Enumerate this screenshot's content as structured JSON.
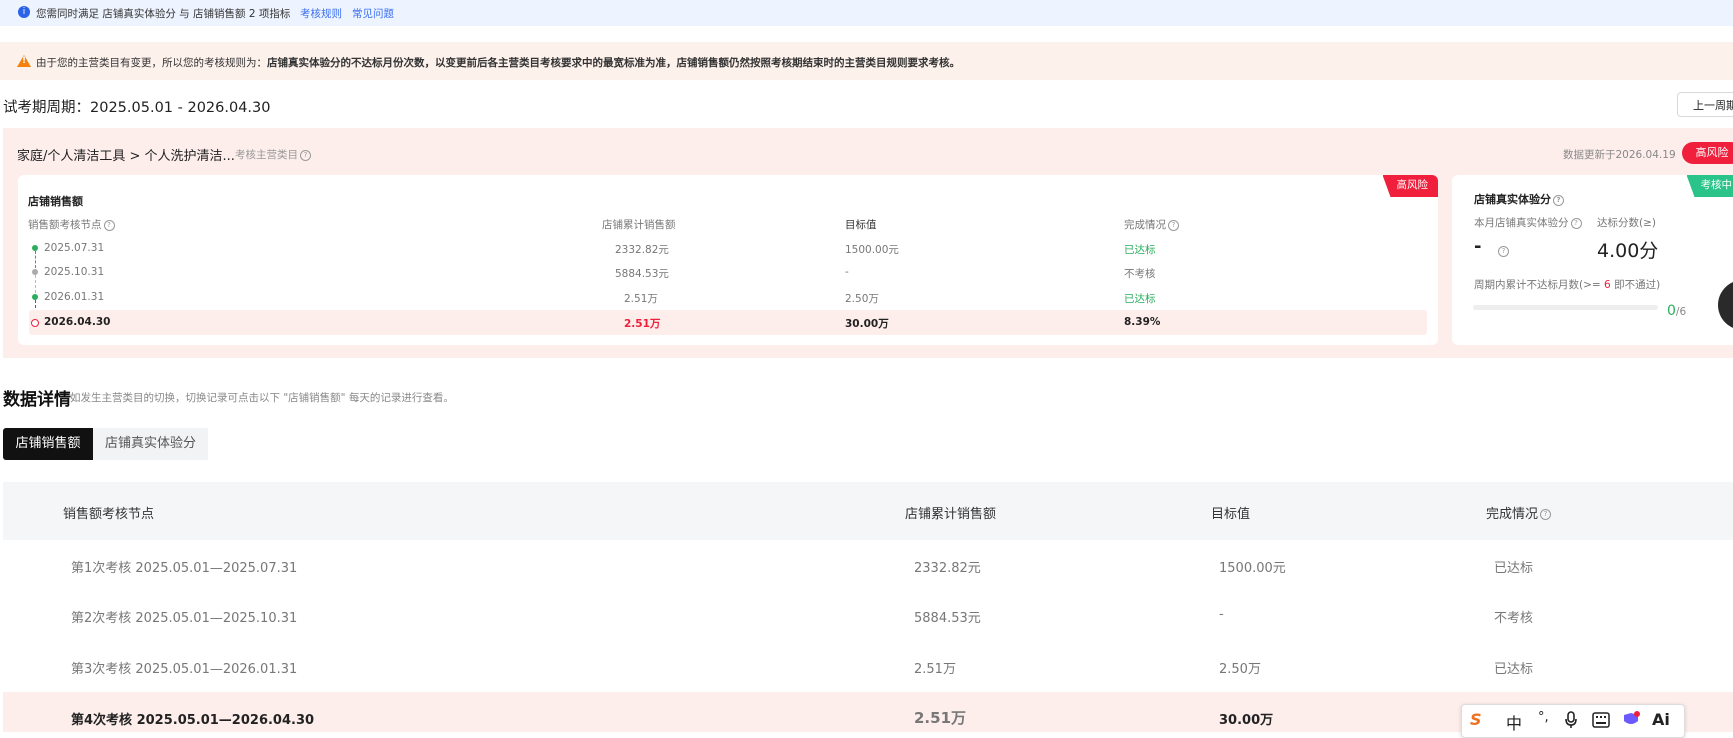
{
  "info": {
    "text": "您需同时满足 店铺真实体验分 与 店铺销售额 2 项指标",
    "link_rules": "考核规则",
    "link_faq": "常见问题"
  },
  "warning": {
    "text": "由于您的主营类目有变更，所以您的考核规则为：",
    "text_bold": "店铺真实体验分的不达标月份次数，以变更前后各主营类目考核要求中的最宽标准为准，店铺销售额仍然按照考核期结束时的主营类目规则要求考核。"
  },
  "period": {
    "label": "试考期周期：2025.05.01 - 2026.04.30",
    "prev_button": "上一周期"
  },
  "risk_panel": {
    "breadcrumb": "家庭/个人清洁工具 > 个人洗护清洁...",
    "breadcrumb_sub": "考核主营类目",
    "updated": "数据更新于2026.04.19",
    "risk_badge": "高风险"
  },
  "sales_card": {
    "corner_tag": "高风险",
    "title": "店铺销售额",
    "headers": {
      "node": "销售额考核节点",
      "cumulative": "店铺累计销售额",
      "target": "目标值",
      "status": "完成情况"
    },
    "rows": [
      {
        "date": "2025.07.31",
        "cumulative": "2332.82元",
        "target": "1500.00元",
        "status": "已达标"
      },
      {
        "date": "2025.10.31",
        "cumulative": "5884.53元",
        "target": "-",
        "status": "不考核"
      },
      {
        "date": "2026.01.31",
        "cumulative": "2.51万",
        "target": "2.50万",
        "status": "已达标"
      },
      {
        "date": "2026.04.30",
        "cumulative": "2.51万",
        "target": "30.00万",
        "status": "8.39%"
      }
    ]
  },
  "experience_card": {
    "corner_tag": "考核中",
    "title": "店铺真实体验分",
    "month_score_label": "本月店铺真实体验分",
    "pass_score_label": "达标分数(≥)",
    "month_score_value": "-",
    "pass_score_value": "4.00分",
    "fail_months_label": "周期内累计不达标月数(>=",
    "fail_months_threshold": "6",
    "fail_months_suffix": "即不通过)",
    "progress_value": "0",
    "progress_total": "/6"
  },
  "details": {
    "title": "数据详情",
    "subtitle": "如发生主营类目的切换，切换记录可点击以下 \"店铺销售额\" 每天的记录进行查看。",
    "tabs": [
      "店铺销售额",
      "店铺真实体验分"
    ],
    "headers": {
      "node": "销售额考核节点",
      "cumulative": "店铺累计销售额",
      "target": "目标值",
      "status": "完成情况"
    },
    "rows": [
      {
        "node": "第1次考核 2025.05.01—2025.07.31",
        "cumulative": "2332.82元",
        "target": "1500.00元",
        "status": "已达标"
      },
      {
        "node": "第2次考核 2025.05.01—2025.10.31",
        "cumulative": "5884.53元",
        "target": "-",
        "status": "不考核"
      },
      {
        "node": "第3次考核 2025.05.01—2026.01.31",
        "cumulative": "2.51万",
        "target": "2.50万",
        "status": "已达标"
      },
      {
        "node": "第4次考核 2025.05.01—2026.04.30",
        "cumulative": "2.51万",
        "target": "30.00万",
        "status": ""
      }
    ]
  },
  "ime": {
    "logo": "S",
    "chinese": "中",
    "punct": "°,",
    "mic": "mic-icon",
    "keyboard": "keyboard-icon",
    "ai": "Ai"
  },
  "colors": {
    "danger": "#f0203c",
    "success": "#2aae5e",
    "accent": "#3a6ff2",
    "warning": "#f5800b"
  }
}
